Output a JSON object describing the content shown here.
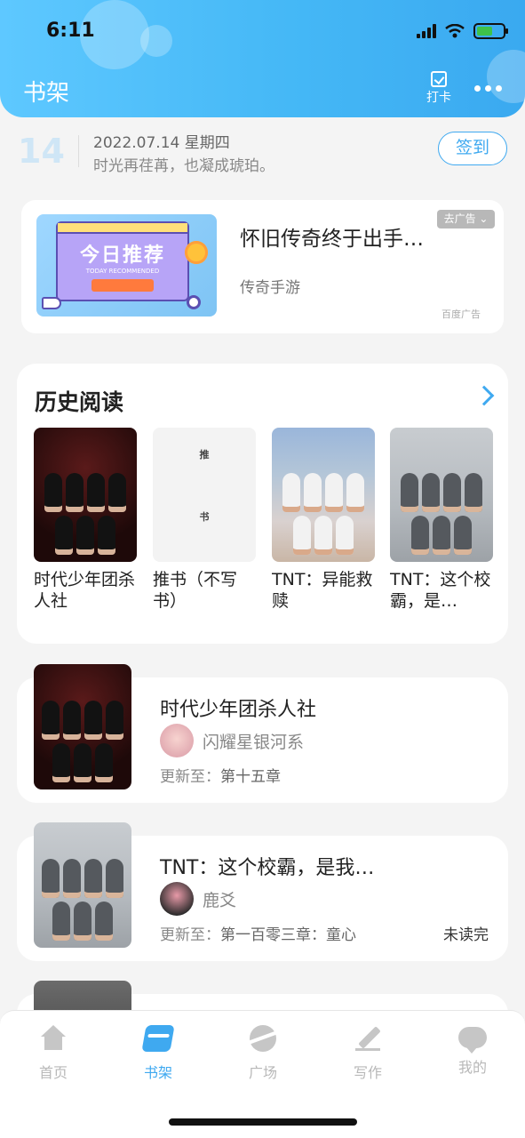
{
  "status": {
    "time": "6:11"
  },
  "header": {
    "title": "书架",
    "checkin_label": "打卡"
  },
  "daily": {
    "day": "14",
    "date": "2022.07.14 星期四",
    "quote": "时光再荏苒，也凝成琥珀。",
    "signin_label": "签到"
  },
  "ad": {
    "title": "怀旧传奇终于出手…",
    "source": "传奇手游",
    "badge": "去广告 ⌄",
    "provider": "百度广告",
    "image_title": "今日推荐",
    "image_subtitle": "TODAY RECOMMENDED"
  },
  "history": {
    "title": "历史阅读",
    "books": [
      {
        "name": "时代少年团杀人社"
      },
      {
        "name": "推书（不写书）",
        "cover_text_1": "推",
        "cover_text_2": "书"
      },
      {
        "name": "TNT：异能救赎"
      },
      {
        "name": "TNT：这个校霸，是…"
      }
    ]
  },
  "list": [
    {
      "title": "时代少年团杀人社",
      "author": "闪耀星银河系",
      "update_prefix": "更新至：",
      "chapter": "第十五章"
    },
    {
      "title": "TNT：这个校霸，是我…",
      "author": "鹿爻",
      "update_prefix": "更新至：",
      "chapter": "第一百零三章：童心",
      "status": "未读完"
    }
  ],
  "nav": {
    "items": [
      {
        "label": "首页",
        "icon": "home-icon"
      },
      {
        "label": "书架",
        "icon": "bookshelf-icon",
        "active": true
      },
      {
        "label": "广场",
        "icon": "plaza-icon"
      },
      {
        "label": "写作",
        "icon": "write-icon"
      },
      {
        "label": "我的",
        "icon": "chat-profile-icon"
      }
    ]
  },
  "colors": {
    "accent": "#3fa9f0",
    "header_start": "#5ec8ff",
    "header_end": "#3aa9f0"
  }
}
